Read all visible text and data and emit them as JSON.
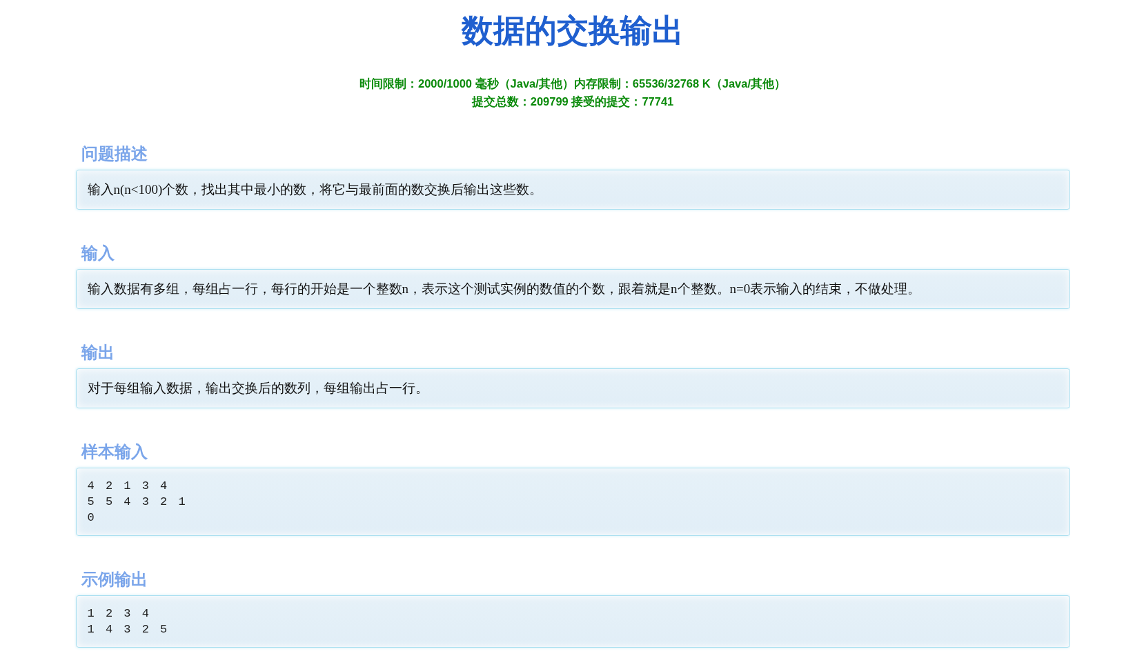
{
  "title": "数据的交换输出",
  "limits": [
    "时间限制：2000/1000 毫秒（Java/其他）内存限制：65536/32768 K（Java/其他）",
    "提交总数：209799 接受的提交：77741"
  ],
  "sections": [
    {
      "heading": "问题描述",
      "kind": "text",
      "lines": [
        "输入n(n<100)个数，找出其中最小的数，将它与最前面的数交换后输出这些数。"
      ]
    },
    {
      "heading": "输入",
      "kind": "text",
      "lines": [
        "输入数据有多组，每组占一行，每行的开始是一个整数n，表示这个测试实例的数值的个数，跟着就是n个整数。n=0表示输入的结束，不做处理。"
      ]
    },
    {
      "heading": "输出",
      "kind": "text",
      "lines": [
        "对于每组输入数据，输出交换后的数列，每组输出占一行。"
      ]
    },
    {
      "heading": "样本输入",
      "kind": "code",
      "lines": [
        "4 2 1 3 4",
        "5 5 4 3 2 1",
        "0"
      ]
    },
    {
      "heading": "示例输出",
      "kind": "code",
      "lines": [
        "1 2 3 4",
        "1 4 3 2 5"
      ]
    }
  ]
}
